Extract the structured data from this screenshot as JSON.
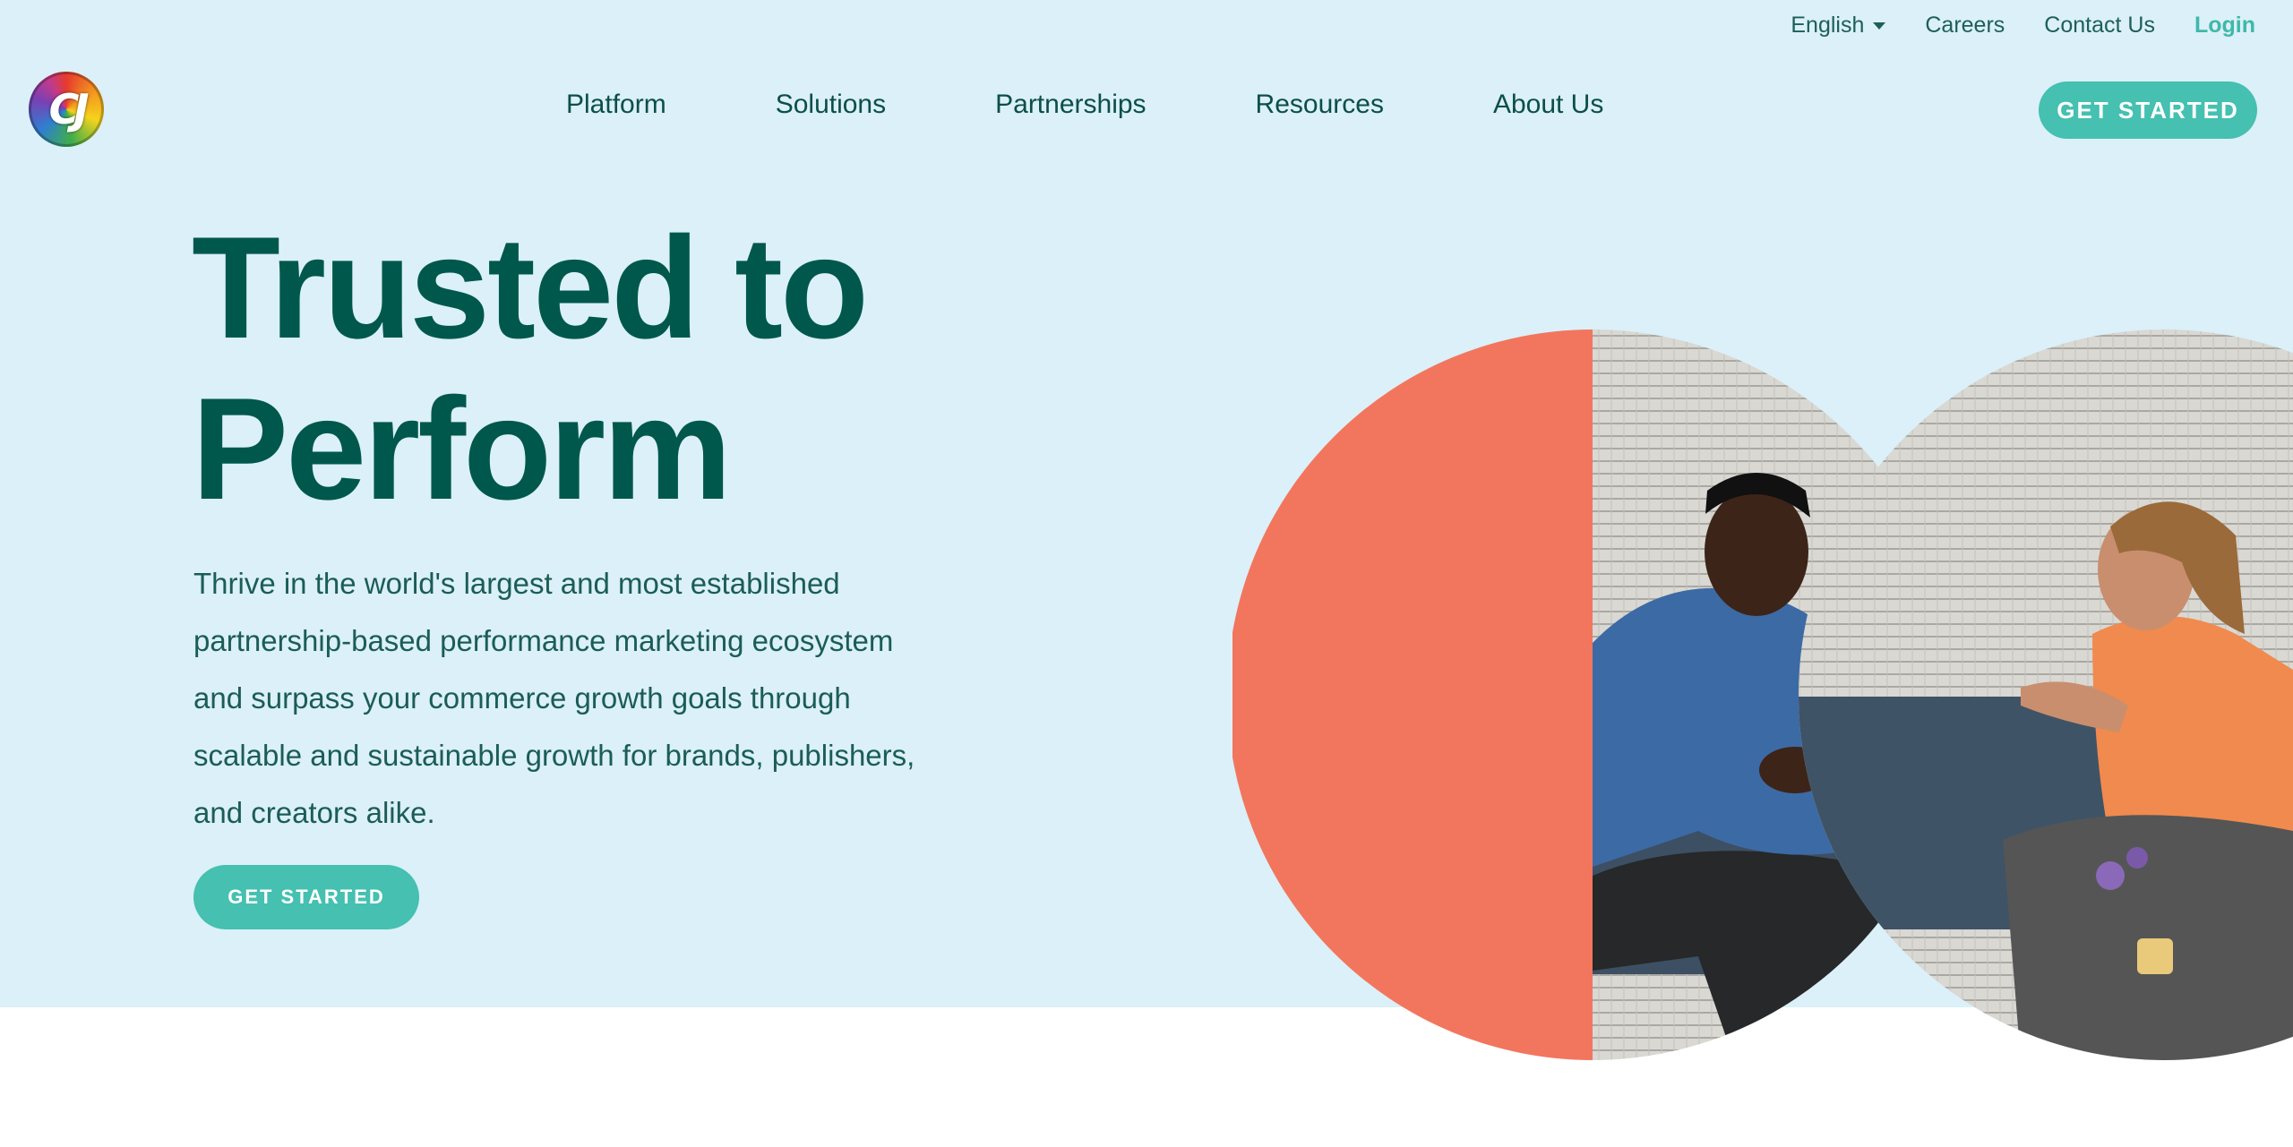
{
  "utility_nav": {
    "language": "English",
    "careers": "Careers",
    "contact": "Contact Us",
    "login": "Login"
  },
  "logo": {
    "text": "CJ"
  },
  "main_nav": {
    "items": [
      "Platform",
      "Solutions",
      "Partnerships",
      "Resources",
      "About Us"
    ]
  },
  "header_cta": "GET STARTED",
  "hero": {
    "title_line1": "Trusted to",
    "title_line2": "Perform",
    "description": "Thrive in the world's largest and most established partnership-based performance marketing ecosystem and surpass your commerce growth goals through scalable and sustainable growth for brands, publishers, and creators alike.",
    "cta": "GET STARTED"
  },
  "colors": {
    "hero_background": "#dbf0f8",
    "brand_dark": "#00584c",
    "accent_teal": "#45c0b1",
    "coral": "#f2765d"
  },
  "icons": [
    "cj-logo-icon",
    "chevron-down-icon"
  ]
}
